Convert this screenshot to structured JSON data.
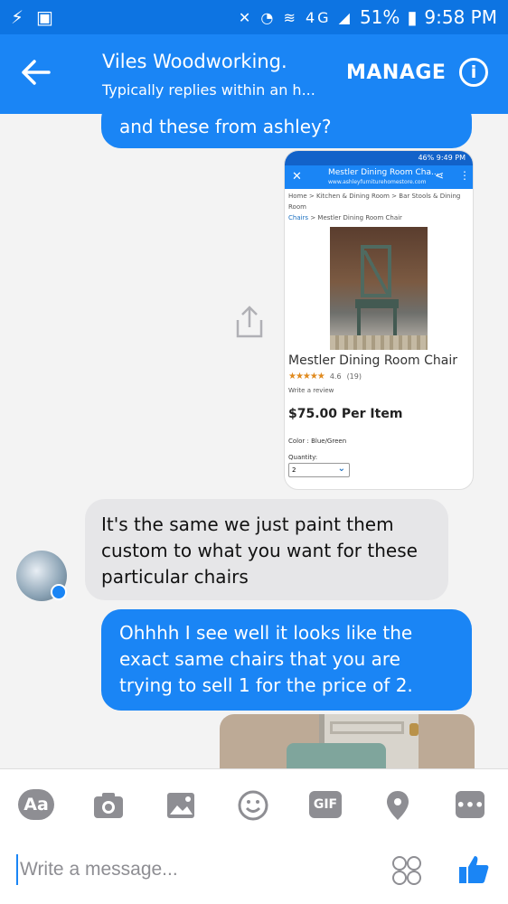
{
  "status_bar": {
    "left_icons": [
      "flash-icon",
      "gallery-icon"
    ],
    "right_icons": [
      "mute-icon",
      "alarm-icon",
      "wifi-icon",
      "4g-icon",
      "signal-icon"
    ],
    "network": "4G",
    "battery": "51%",
    "time": "9:58 PM"
  },
  "header": {
    "title": "Viles Woodworking.",
    "subtitle": "Typically replies within an h...",
    "manage_label": "MANAGE",
    "info_label": "i"
  },
  "messages": {
    "outgoing_1": "and these from ashley?",
    "incoming_1": "It's the same we just paint them custom to what you want for these particular chairs",
    "outgoing_2": "Ohhhh I see well it looks like the exact same chairs that you are trying to sell 1 for the price of 2."
  },
  "screenshot_attachment": {
    "status": "46% 9:49 PM",
    "page_title": "Mestler Dining Room Cha...",
    "url": "www.ashleyfurniturehomestore.com",
    "breadcrumb": "Home  >  Kitchen & Dining Room  >  Bar Stools & Dining Room",
    "breadcrumb_link": "Chairs",
    "breadcrumb_current": "Mestler Dining Room Chair",
    "product_name": "Mestler Dining Room Chair",
    "stars": "★★★★★",
    "rating": "4.6",
    "review_count": "(19)",
    "write_review": "Write a review",
    "price": "$75.00  Per Item",
    "color": "Color : Blue/Green",
    "quantity_label": "Quantity:",
    "quantity_value": "2"
  },
  "composer": {
    "aa_label": "Aa",
    "gif_label": "GIF",
    "more_label": "•••",
    "placeholder": "Write a message..."
  }
}
